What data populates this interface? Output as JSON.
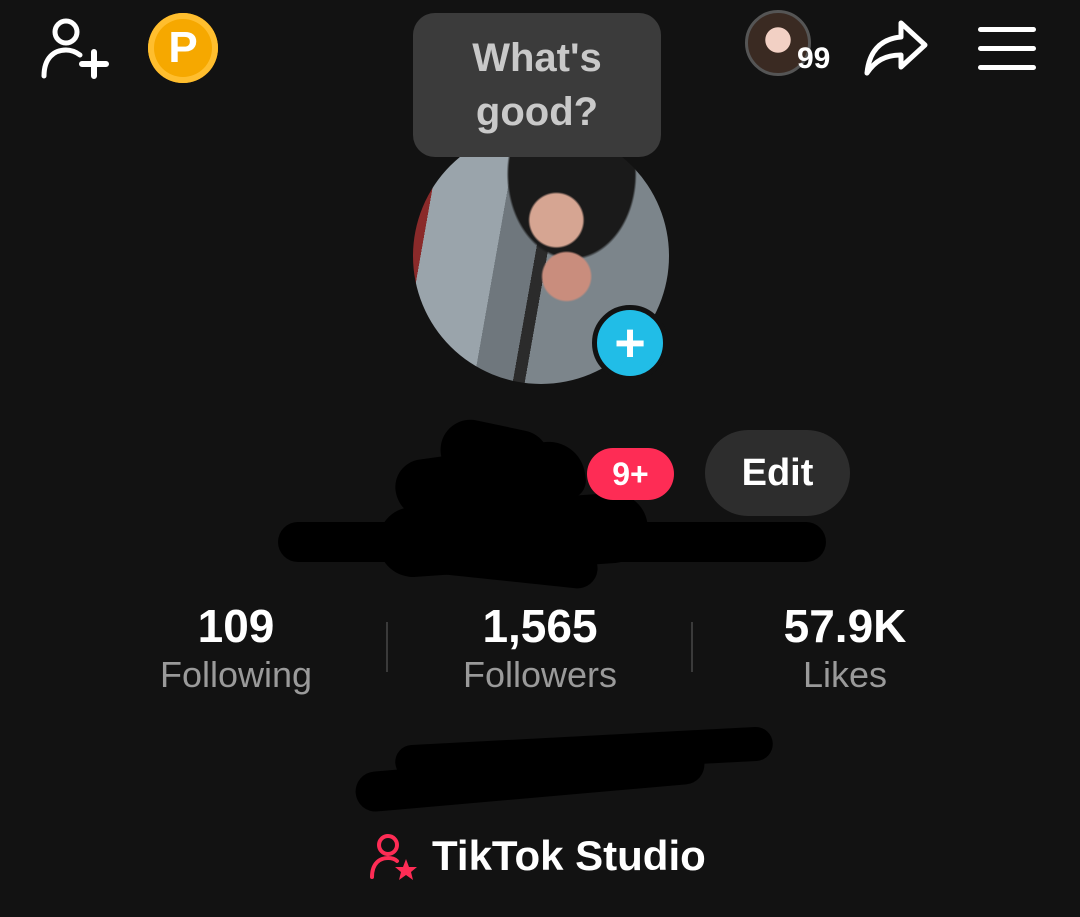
{
  "header": {
    "add_friend_icon": "person-plus-icon",
    "coin_icon": "coin-icon",
    "coin_letter": "P",
    "story_avatar_icon": "story-avatar-icon",
    "story_count": "99",
    "share_icon": "share-arrow-icon",
    "menu_icon": "hamburger-menu-icon"
  },
  "note_bubble": {
    "text": "What's good?"
  },
  "profile": {
    "avatar_add_label": "+",
    "notification_badge": "9+",
    "edit_label": "Edit"
  },
  "stats": [
    {
      "value": "109",
      "label": "Following"
    },
    {
      "value": "1,565",
      "label": "Followers"
    },
    {
      "value": "57.9K",
      "label": "Likes"
    }
  ],
  "studio": {
    "icon": "person-star-icon",
    "label": "TikTok Studio"
  },
  "colors": {
    "background": "#121212",
    "accent_red": "#fe2c55",
    "accent_blue": "#21bde7",
    "coin_gold": "#f6a800",
    "button_gray": "#2d2d2d"
  }
}
